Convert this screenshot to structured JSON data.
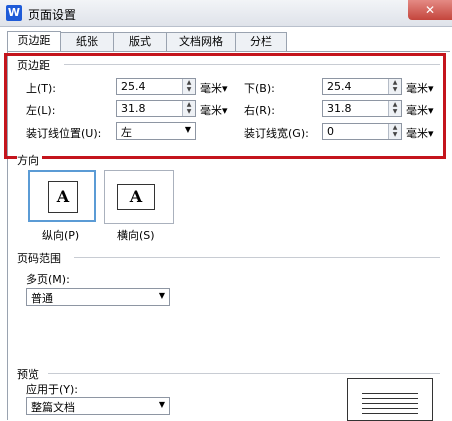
{
  "window": {
    "app_icon": "W",
    "title": "页面设置",
    "close": "✕"
  },
  "tabs": [
    "页边距",
    "纸张",
    "版式",
    "文档网格",
    "分栏"
  ],
  "margins": {
    "group": "页边距",
    "top_label": "上(T):",
    "top_value": "25.4",
    "bottom_label": "下(B):",
    "bottom_value": "25.4",
    "left_label": "左(L):",
    "left_value": "31.8",
    "right_label": "右(R):",
    "right_value": "31.8",
    "gutter_pos_label": "装订线位置(U):",
    "gutter_pos_value": "左",
    "gutter_width_label": "装订线宽(G):",
    "gutter_width_value": "0",
    "unit": "毫米▾"
  },
  "orientation": {
    "group": "方向",
    "portrait": "纵向(P)",
    "landscape": "横向(S)",
    "icon_letter": "A"
  },
  "pages": {
    "group": "页码范围",
    "multi_label": "多页(M):",
    "multi_value": "普通"
  },
  "preview": {
    "group": "预览",
    "apply_label": "应用于(Y):",
    "apply_value": "整篇文档"
  },
  "colors": {
    "highlight": "#c4141c",
    "selected_border": "#5b9bd5",
    "app_icon_bg": "#1e5bd8"
  }
}
